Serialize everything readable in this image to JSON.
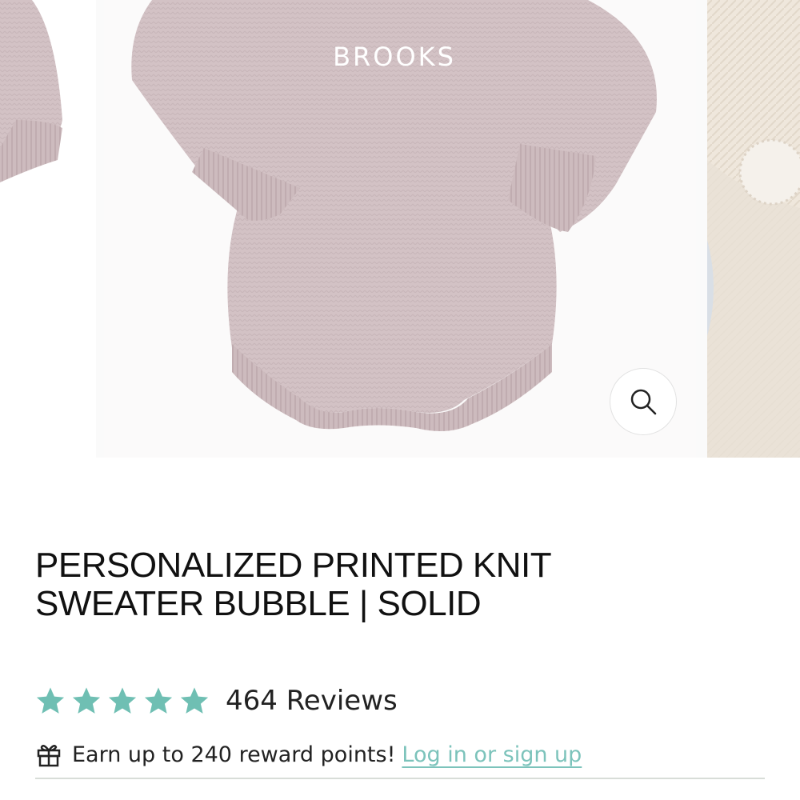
{
  "gallery": {
    "main_image_print": "BROOKS",
    "zoom_label": "zoom-image"
  },
  "product": {
    "title_line1": "PERSONALIZED PRINTED KNIT",
    "title_line2": "SWEATER BUBBLE | SOLID"
  },
  "rating": {
    "stars_filled": 5,
    "stars_total": 5,
    "reviews_text": "464 Reviews"
  },
  "rewards": {
    "text": "Earn up to 240 reward points!",
    "link_text": "Log in or sign up"
  },
  "colors": {
    "accent": "#6fbfb3",
    "link": "#7cc3bb",
    "knit": "#d4c3c6",
    "text": "#111111"
  }
}
